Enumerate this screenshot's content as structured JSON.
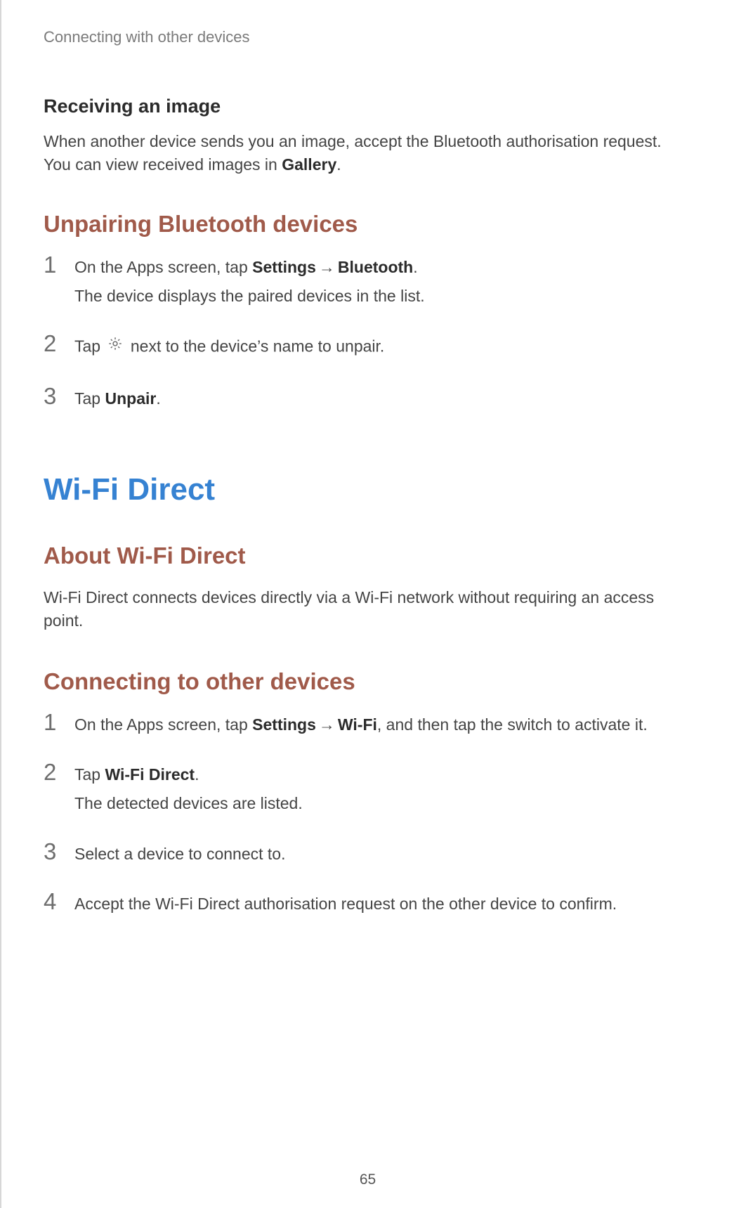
{
  "header": {
    "breadcrumb": "Connecting with other devices"
  },
  "section_receiving": {
    "title": "Receiving an image",
    "body_pre": "When another device sends you an image, accept the Bluetooth authorisation request. You can view received images in ",
    "body_bold": "Gallery",
    "body_post": "."
  },
  "section_unpair": {
    "title": "Unpairing Bluetooth devices",
    "steps": [
      {
        "num": "1",
        "line1_pre": "On the Apps screen, tap ",
        "line1_b1": "Settings",
        "line1_arrow": "→",
        "line1_b2": "Bluetooth",
        "line1_post": ".",
        "line2": "The device displays the paired devices in the list."
      },
      {
        "num": "2",
        "line1_pre": "Tap ",
        "line1_post": " next to the device’s name to unpair."
      },
      {
        "num": "3",
        "line1_pre": "Tap ",
        "line1_b1": "Unpair",
        "line1_post": "."
      }
    ]
  },
  "section_wifi": {
    "title": "Wi-Fi Direct"
  },
  "section_about": {
    "title": "About Wi-Fi Direct",
    "body": "Wi-Fi Direct connects devices directly via a Wi-Fi network without requiring an access point."
  },
  "section_connecting": {
    "title": "Connecting to other devices",
    "steps": [
      {
        "num": "1",
        "line1_pre": "On the Apps screen, tap ",
        "line1_b1": "Settings",
        "line1_arrow": "→",
        "line1_b2": "Wi-Fi",
        "line1_post": ", and then tap the switch to activate it."
      },
      {
        "num": "2",
        "line1_pre": "Tap ",
        "line1_b1": "Wi-Fi Direct",
        "line1_post": ".",
        "line2": "The detected devices are listed."
      },
      {
        "num": "3",
        "line1": "Select a device to connect to."
      },
      {
        "num": "4",
        "line1": "Accept the Wi-Fi Direct authorisation request on the other device to confirm."
      }
    ]
  },
  "page_number": "65"
}
